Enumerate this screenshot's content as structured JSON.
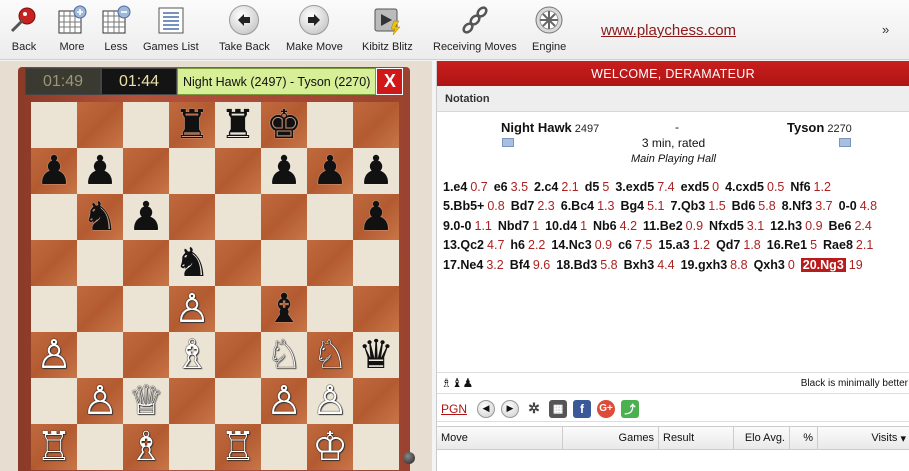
{
  "toolbar": {
    "back": "Back",
    "more": "More",
    "less": "Less",
    "games_list": "Games List",
    "take_back": "Take Back",
    "make_move": "Make Move",
    "kibitz_blitz": "Kibitz Blitz",
    "receiving_moves": "Receiving Moves",
    "engine": "Engine",
    "website": "www.playchess.com",
    "overflow": "»"
  },
  "clock": {
    "white_time": "01:49",
    "black_time": "01:44",
    "players": "Night Hawk (2497) - Tyson (2270)",
    "close": "X"
  },
  "board": [
    [
      "",
      "",
      "",
      "♜",
      "♜",
      "♚",
      "",
      ""
    ],
    [
      "♟",
      "♟",
      "",
      "",
      "",
      "♟",
      "♟",
      "♟"
    ],
    [
      "",
      "♞",
      "♟",
      "",
      "",
      "",
      "",
      "♟"
    ],
    [
      "",
      "",
      "",
      "♞",
      "",
      "",
      "",
      ""
    ],
    [
      "",
      "",
      "",
      "♙",
      "",
      "♝",
      "",
      ""
    ],
    [
      "♙",
      "",
      "",
      "♗",
      "",
      "♘",
      "♘",
      "♛"
    ],
    [
      "",
      "♙",
      "♕",
      "",
      "",
      "♙",
      "♙",
      ""
    ],
    [
      "♖",
      "",
      "♗",
      "",
      "♖",
      "",
      "♔",
      ""
    ]
  ],
  "panel": {
    "welcome": "WELCOME, DERAMATEUR",
    "notation_label": "Notation",
    "white_name": "Night Hawk",
    "white_elo": "2497",
    "black_name": "Tyson",
    "black_elo": "2270",
    "separator": "-",
    "time_control": "3 min, rated",
    "room": "Main Playing Hall"
  },
  "moves": [
    [
      [
        "1.e4",
        "0.7"
      ],
      [
        "e6",
        "3.5"
      ],
      [
        "2.c4",
        "2.1"
      ],
      [
        "d5",
        "5"
      ],
      [
        "3.exd5",
        "7.4"
      ],
      [
        "exd5",
        "0"
      ],
      [
        "4.cxd5",
        "0.5"
      ],
      [
        "Nf6",
        "1.2"
      ]
    ],
    [
      [
        "5.Bb5+",
        "0.8"
      ],
      [
        "Bd7",
        "2.3"
      ],
      [
        "6.Bc4",
        "1.3"
      ],
      [
        "Bg4",
        "5.1"
      ],
      [
        "7.Qb3",
        "1.5"
      ],
      [
        "Bd6",
        "5.8"
      ],
      [
        "8.Nf3",
        "3.7"
      ],
      [
        "0-0",
        "4.8"
      ]
    ],
    [
      [
        "9.0-0",
        "1.1"
      ],
      [
        "Nbd7",
        "1"
      ],
      [
        "10.d4",
        "1"
      ],
      [
        "Nb6",
        "4.2"
      ],
      [
        "11.Be2",
        "0.9"
      ],
      [
        "Nfxd5",
        "3.1"
      ],
      [
        "12.h3",
        "0.9"
      ],
      [
        "Be6",
        "2.4"
      ]
    ],
    [
      [
        "13.Qc2",
        "4.7"
      ],
      [
        "h6",
        "2.2"
      ],
      [
        "14.Nc3",
        "0.9"
      ],
      [
        "c6",
        "7.5"
      ],
      [
        "15.a3",
        "1.2"
      ],
      [
        "Qd7",
        "1.8"
      ],
      [
        "16.Re1",
        "5"
      ],
      [
        "Rae8",
        "2.1"
      ]
    ],
    [
      [
        "17.Ne4",
        "3.2"
      ],
      [
        "Bf4",
        "9.6"
      ],
      [
        "18.Bd3",
        "5.8"
      ],
      [
        "Bxh3",
        "4.4"
      ],
      [
        "19.gxh3",
        "8.8"
      ],
      [
        "Qxh3",
        "0"
      ],
      [
        "20.Ng3",
        "19"
      ]
    ]
  ],
  "current_move": "20.Ng3",
  "status": {
    "pieces": "♗♝♟",
    "text": "Black is minimally better"
  },
  "buttons": {
    "pgn": "PGN"
  },
  "table": {
    "move": "Move",
    "games": "Games",
    "result": "Result",
    "elo_avg": "Elo Avg.",
    "percent": "%",
    "visits": "Visits"
  }
}
